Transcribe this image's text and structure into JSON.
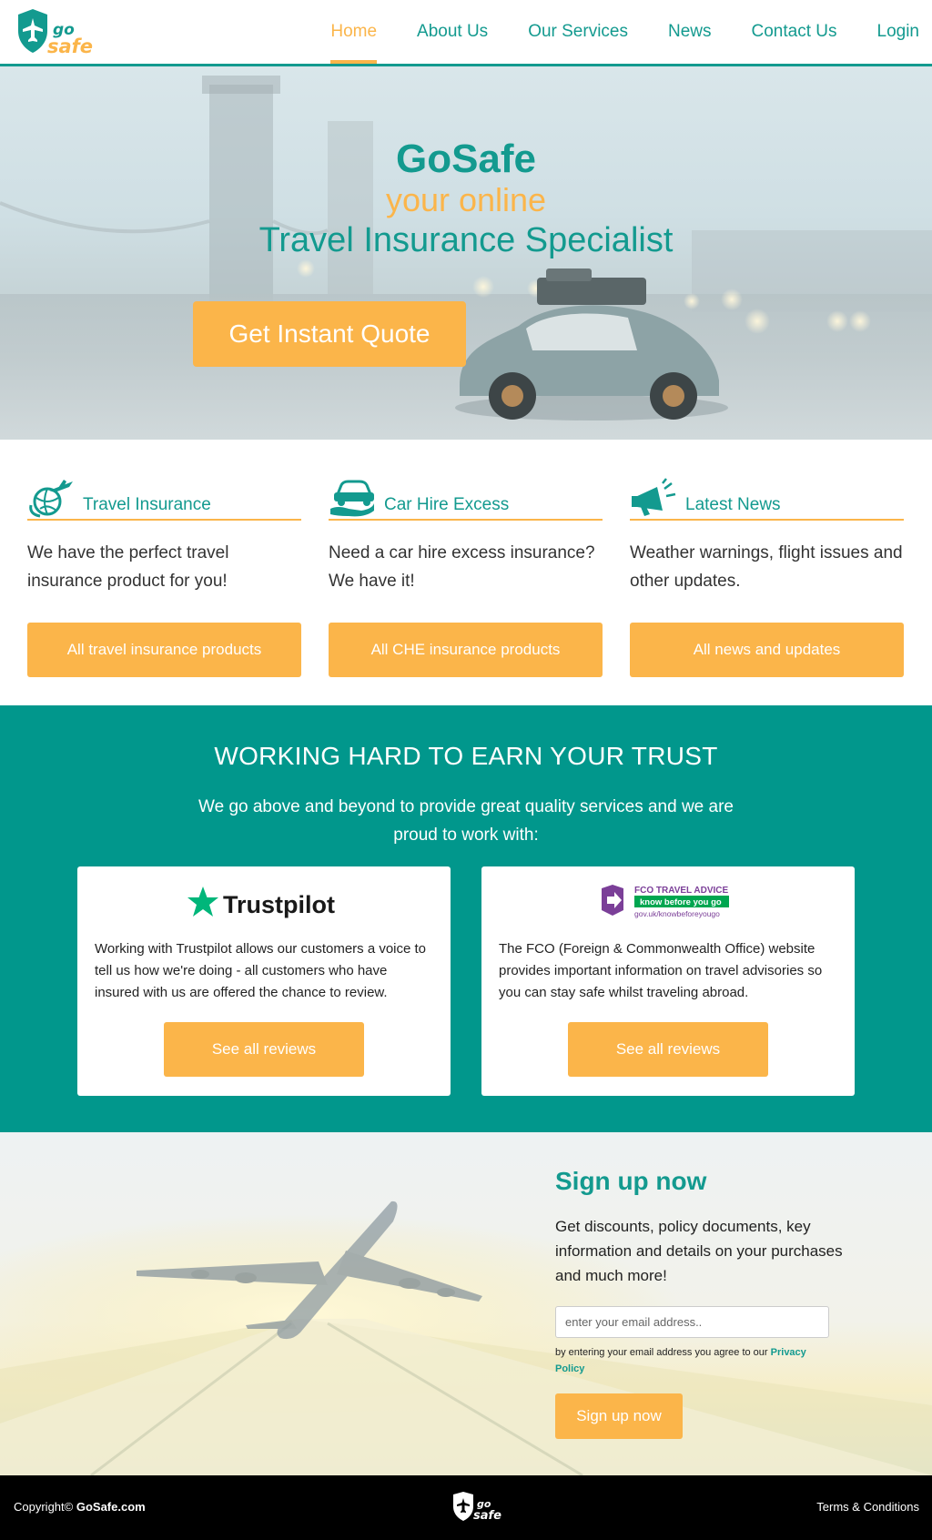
{
  "header": {
    "logo_text_top": "go",
    "logo_text_bottom": "safe",
    "nav": [
      {
        "label": "Home",
        "active": true
      },
      {
        "label": "About Us"
      },
      {
        "label": "Our Services"
      },
      {
        "label": "News"
      },
      {
        "label": "Contact Us"
      },
      {
        "label": "Login"
      }
    ]
  },
  "hero": {
    "brand": "GoSafe",
    "line1": "your online",
    "line2": "Travel Insurance Specialist",
    "cta": "Get Instant Quote"
  },
  "services": [
    {
      "icon": "globe-plane-icon",
      "title": "Travel Insurance",
      "text": "We have the perfect travel insurance product for you!",
      "button": "All travel insurance products"
    },
    {
      "icon": "car-hand-icon",
      "title": "Car Hire Excess",
      "text": "Need a car hire excess insurance? We have it!",
      "button": "All CHE insurance products"
    },
    {
      "icon": "megaphone-icon",
      "title": "Latest News",
      "text": "Weather warnings, flight issues and other updates.",
      "button": "All news and updates"
    }
  ],
  "trust": {
    "title": "WORKING HARD TO EARN YOUR TRUST",
    "description": "We go above and beyond to provide great quality services and we are proud to work with:",
    "cards": [
      {
        "logo_text": "Trustpilot",
        "text": "Working with Trustpilot allows our customers a voice to tell us how we're doing - all customers who have insured with us are offered the chance to review.",
        "button": "See all reviews"
      },
      {
        "logo_title": "FCO TRAVEL ADVICE",
        "logo_tag": "know before you go",
        "logo_url": "gov.uk/knowbeforeyougo",
        "text": "The FCO (Foreign & Commonwealth Office) website provides important information on travel advisories so you can stay safe whilst traveling abroad.",
        "button": "See all reviews"
      }
    ]
  },
  "signup": {
    "title": "Sign up now",
    "text": "Get discounts, policy documents, key information and details on your purchases and much more!",
    "placeholder": "enter your email address..",
    "note": "by entering your email address you agree to our",
    "note_link": "Privacy Policy",
    "button": "Sign up now"
  },
  "footer": {
    "copyright": "Copyright©",
    "site": "GoSafe.com",
    "terms": "Terms & Conditions"
  },
  "colors": {
    "teal": "#139a8f",
    "teal_bg": "#01978c",
    "orange": "#fbb54a"
  }
}
